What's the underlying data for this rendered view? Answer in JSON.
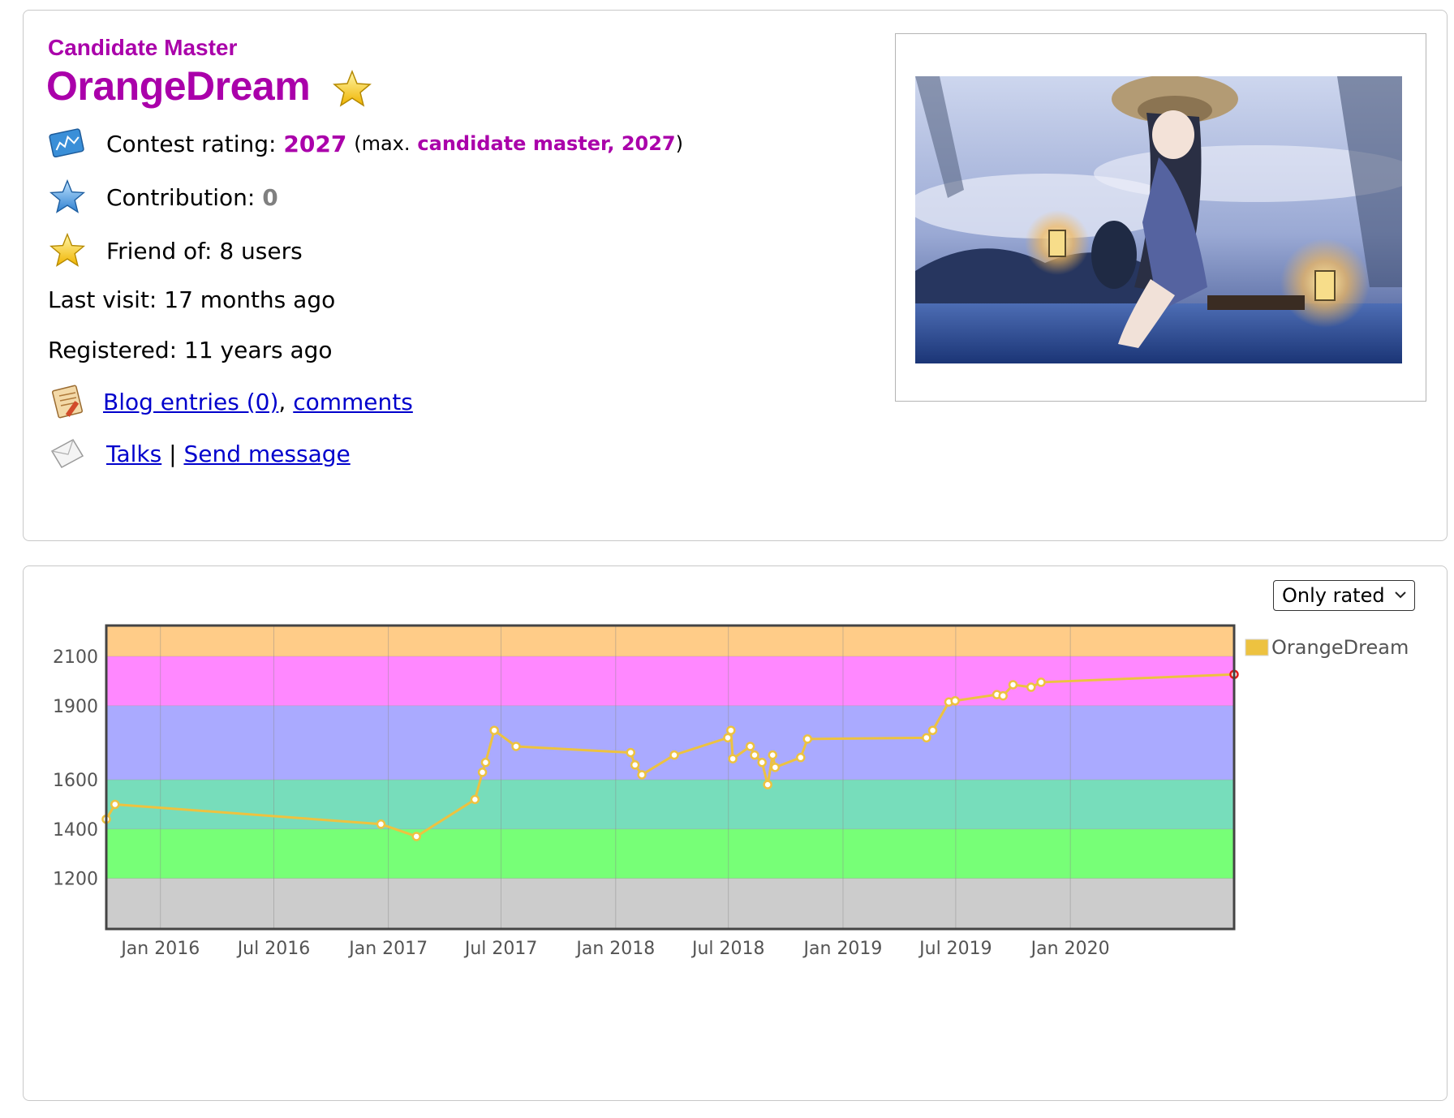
{
  "profile": {
    "rank": "Candidate Master",
    "handle": "OrangeDream",
    "rating_label": "Contest rating:",
    "rating_value": "2027",
    "max_prefix": "(max.",
    "max_value": "candidate master, 2027",
    "max_suffix": ")",
    "contribution_label": "Contribution:",
    "contribution_value": "0",
    "friend_label": "Friend of:",
    "friend_value": "8 users",
    "last_visit_label": "Last visit:",
    "last_visit_value": "17 months ago",
    "registered_label": "Registered:",
    "registered_value": "11 years ago",
    "blog_link": "Blog entries (0)",
    "comments_link": "comments",
    "talks_link": "Talks",
    "separator": "|",
    "send_message_link": "Send message",
    "colors": {
      "accent": "#aa00aa",
      "link": "#0000cc"
    }
  },
  "graph": {
    "filter_selected": "Only rated",
    "legend_label": "OrangeDream"
  },
  "chart_data": {
    "type": "line",
    "xlabel": "",
    "ylabel": "",
    "x_ticks": [
      "Jan 2016",
      "Jul 2016",
      "Jan 2017",
      "Jul 2017",
      "Jan 2018",
      "Jul 2018",
      "Jan 2019",
      "Jul 2019",
      "Jan 2020"
    ],
    "y_ticks": [
      1200,
      1400,
      1600,
      1900,
      2100
    ],
    "ylim": [
      995,
      2225
    ],
    "xlim": [
      "2015-10-06",
      "2020-09-20"
    ],
    "grid": true,
    "legend_position": "top-right",
    "bands": [
      {
        "from": 0,
        "to": 1200,
        "color": "#cccccc"
      },
      {
        "from": 1200,
        "to": 1400,
        "color": "#77ff77"
      },
      {
        "from": 1400,
        "to": 1600,
        "color": "#77ddbb"
      },
      {
        "from": 1600,
        "to": 1900,
        "color": "#aaaaff"
      },
      {
        "from": 1900,
        "to": 2100,
        "color": "#ff88ff"
      },
      {
        "from": 2100,
        "to": 2225,
        "color": "#ffcc88"
      }
    ],
    "series": [
      {
        "name": "OrangeDream",
        "color": "#edc240",
        "points": [
          [
            "2015-10-06",
            1440
          ],
          [
            "2015-10-20",
            1500
          ],
          [
            "2016-12-20",
            1420
          ],
          [
            "2017-02-15",
            1370
          ],
          [
            "2017-05-20",
            1520
          ],
          [
            "2017-06-01",
            1630
          ],
          [
            "2017-06-06",
            1670
          ],
          [
            "2017-06-20",
            1800
          ],
          [
            "2017-07-25",
            1735
          ],
          [
            "2018-01-25",
            1710
          ],
          [
            "2018-02-01",
            1660
          ],
          [
            "2018-02-12",
            1620
          ],
          [
            "2018-04-05",
            1700
          ],
          [
            "2018-06-30",
            1770
          ],
          [
            "2018-07-05",
            1800
          ],
          [
            "2018-07-08",
            1685
          ],
          [
            "2018-08-05",
            1735
          ],
          [
            "2018-08-12",
            1700
          ],
          [
            "2018-08-24",
            1670
          ],
          [
            "2018-09-02",
            1580
          ],
          [
            "2018-09-10",
            1700
          ],
          [
            "2018-09-14",
            1650
          ],
          [
            "2018-10-25",
            1690
          ],
          [
            "2018-11-05",
            1765
          ],
          [
            "2019-05-15",
            1770
          ],
          [
            "2019-05-25",
            1800
          ],
          [
            "2019-06-20",
            1915
          ],
          [
            "2019-06-30",
            1920
          ],
          [
            "2019-09-05",
            1945
          ],
          [
            "2019-09-15",
            1940
          ],
          [
            "2019-10-01",
            1985
          ],
          [
            "2019-10-30",
            1975
          ],
          [
            "2019-11-15",
            1995
          ],
          [
            "2020-09-20",
            2027
          ]
        ]
      }
    ]
  }
}
